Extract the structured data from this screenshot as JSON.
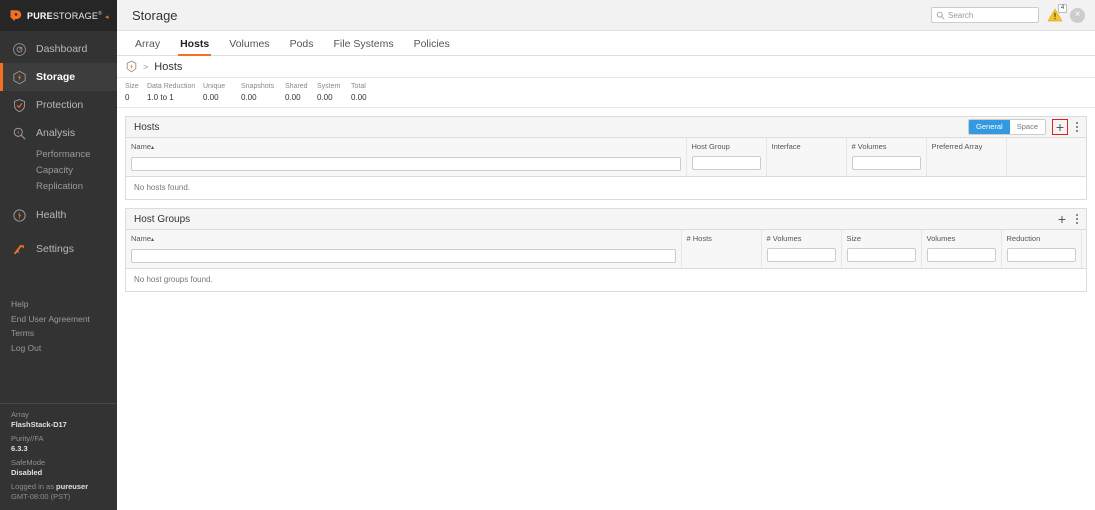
{
  "sidebar": {
    "logo": {
      "bold": "PURE",
      "light": "STORAGE",
      "registered": "®",
      "dot": "◂",
      "icon": "pure-storage-logo-icon"
    },
    "items": [
      {
        "label": "Dashboard",
        "icon": "dashboard-icon",
        "active": false
      },
      {
        "label": "Storage",
        "icon": "storage-icon",
        "active": true
      },
      {
        "label": "Protection",
        "icon": "shield-icon",
        "active": false
      },
      {
        "label": "Analysis",
        "icon": "magnifier-icon",
        "active": false
      },
      {
        "label": "Health",
        "icon": "health-icon",
        "active": false
      },
      {
        "label": "Settings",
        "icon": "gear-icon",
        "active": false
      }
    ],
    "analysis_sub": [
      "Performance",
      "Capacity",
      "Replication"
    ],
    "util_links": [
      "Help",
      "End User Agreement",
      "Terms",
      "Log Out"
    ],
    "footer": {
      "array_key": "Array",
      "array_value": "FlashStack-D17",
      "purity_key": "Purity//FA",
      "purity_value": "6.3.3",
      "safemode_key": "SafeMode",
      "safemode_value": "Disabled",
      "logged_in_prefix": "Logged in as ",
      "logged_in_user": "pureuser",
      "timezone": "GMT-08:00 (PST)"
    }
  },
  "header": {
    "title": "Storage",
    "search": {
      "placeholder": "Search",
      "value": "",
      "icon": "search-icon"
    },
    "alert": {
      "icon": "warning-triangle-icon",
      "badge": "4"
    },
    "close": {
      "icon": "close-icon",
      "glyph": "×"
    }
  },
  "tabs": [
    {
      "label": "Array",
      "active": false
    },
    {
      "label": "Hosts",
      "active": true
    },
    {
      "label": "Volumes",
      "active": false
    },
    {
      "label": "Pods",
      "active": false
    },
    {
      "label": "File Systems",
      "active": false
    },
    {
      "label": "Policies",
      "active": false
    }
  ],
  "breadcrumb": {
    "icon": "array-icon",
    "separator": ">",
    "current": "Hosts"
  },
  "stats": [
    {
      "key": "Size",
      "value": "0"
    },
    {
      "key": "Data Reduction",
      "value": "1.0 to 1"
    },
    {
      "key": "Unique",
      "value": "0.00"
    },
    {
      "key": "Snapshots",
      "value": "0.00"
    },
    {
      "key": "Shared",
      "value": "0.00"
    },
    {
      "key": "System",
      "value": "0.00"
    },
    {
      "key": "Total",
      "value": "0.00"
    }
  ],
  "hosts_panel": {
    "title": "Hosts",
    "view_toggle": [
      {
        "label": "General",
        "active": true
      },
      {
        "label": "Space",
        "active": false
      }
    ],
    "add_button": {
      "glyph": "+",
      "highlighted": true
    },
    "menu_icon": "kebab-menu-icon",
    "columns": [
      {
        "label": "Name",
        "sort": "▴",
        "filter": true,
        "value": ""
      },
      {
        "label": "Host Group",
        "sort": "",
        "filter": true,
        "value": ""
      },
      {
        "label": "Interface",
        "sort": "",
        "filter": false,
        "value": ""
      },
      {
        "label": "# Volumes",
        "sort": "",
        "filter": true,
        "value": ""
      },
      {
        "label": "Preferred Array",
        "sort": "",
        "filter": false,
        "value": ""
      },
      {
        "label": "",
        "sort": "",
        "filter": false,
        "value": ""
      }
    ],
    "empty_message": "No hosts found."
  },
  "host_groups_panel": {
    "title": "Host Groups",
    "add_button": {
      "glyph": "+",
      "highlighted": false
    },
    "menu_icon": "kebab-menu-icon",
    "columns": [
      {
        "label": "Name",
        "sort": "▴",
        "filter": true,
        "value": ""
      },
      {
        "label": "# Hosts",
        "sort": "",
        "filter": false,
        "value": ""
      },
      {
        "label": "# Volumes",
        "sort": "",
        "filter": true,
        "value": ""
      },
      {
        "label": "Size",
        "sort": "",
        "filter": true,
        "value": ""
      },
      {
        "label": "Volumes",
        "sort": "",
        "filter": true,
        "value": ""
      },
      {
        "label": "Reduction",
        "sort": "",
        "filter": true,
        "value": ""
      },
      {
        "label": "",
        "sort": "",
        "filter": false,
        "value": ""
      }
    ],
    "empty_message": "No host groups found."
  },
  "colors": {
    "brand_orange": "#f4721f",
    "sidebar_bg": "#333333",
    "accent_blue": "#3399e0",
    "highlight_red": "#e02020"
  }
}
